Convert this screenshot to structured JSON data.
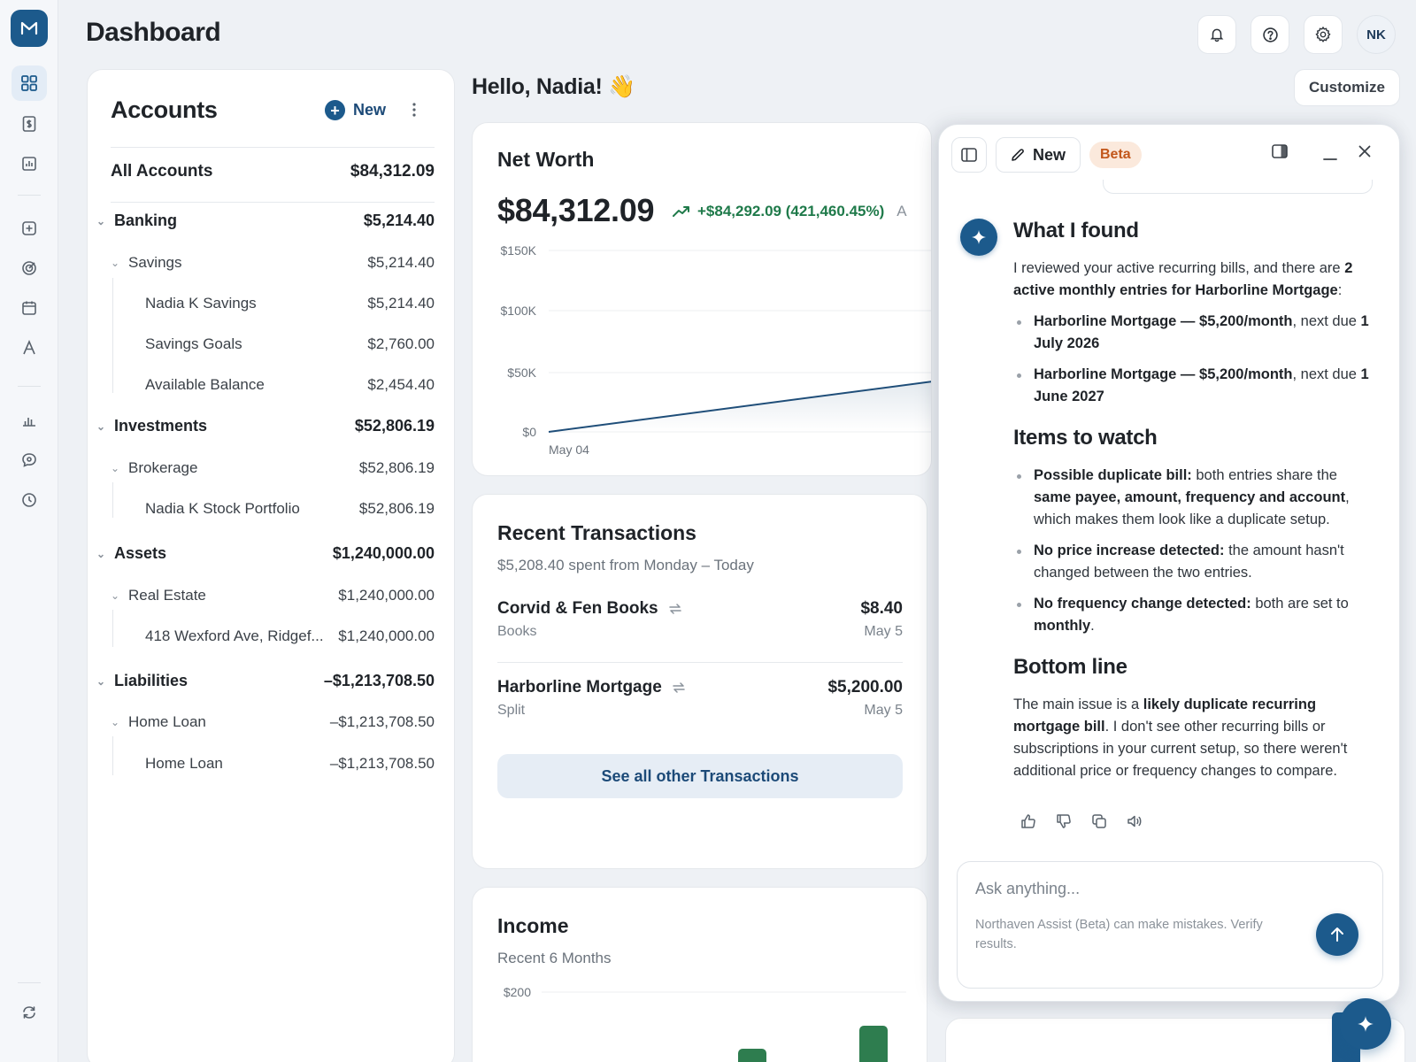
{
  "header": {
    "title": "Dashboard",
    "avatar_initials": "NK"
  },
  "rail": {
    "logo_letter": "M",
    "icons": [
      "grid-icon",
      "dollar-document-icon",
      "bar-chart-icon",
      "plus-square-icon",
      "target-icon",
      "calendar-icon",
      "font-icon",
      "stats-icon",
      "chat-dollar-icon",
      "clock-icon",
      "sync-icon"
    ]
  },
  "accounts": {
    "title": "Accounts",
    "new_label": "New",
    "all": {
      "label": "All Accounts",
      "value": "$84,312.09"
    },
    "groups": [
      {
        "label": "Banking",
        "value": "$5,214.40"
      },
      {
        "label": "Savings",
        "value": "$5,214.40"
      },
      {
        "label": "Nadia K Savings",
        "value": "$5,214.40"
      },
      {
        "label": "Savings Goals",
        "value": "$2,760.00"
      },
      {
        "label": "Available Balance",
        "value": "$2,454.40"
      },
      {
        "label": "Investments",
        "value": "$52,806.19"
      },
      {
        "label": "Brokerage",
        "value": "$52,806.19"
      },
      {
        "label": "Nadia K Stock Portfolio",
        "value": "$52,806.19"
      },
      {
        "label": "Assets",
        "value": "$1,240,000.00"
      },
      {
        "label": "Real Estate",
        "value": "$1,240,000.00"
      },
      {
        "label": "418 Wexford Ave, Ridgef...",
        "value": "$1,240,000.00"
      },
      {
        "label": "Liabilities",
        "value": "–$1,213,708.50"
      },
      {
        "label": "Home Loan",
        "value": "–$1,213,708.50"
      },
      {
        "label": "Home Loan",
        "value": "–$1,213,708.50"
      }
    ]
  },
  "greeting": "Hello, Nadia! 👋",
  "customize_label": "Customize",
  "net_worth": {
    "title": "Net Worth",
    "value": "$84,312.09",
    "change": "+$84,292.09 (421,460.45%)",
    "change_clipped": "A",
    "y_ticks": [
      "$150K",
      "$100K",
      "$50K",
      "$0"
    ],
    "x_tick": "May 04",
    "accent": "#1f4e79"
  },
  "transactions": {
    "title": "Recent Transactions",
    "subtitle": "$5,208.40 spent from Monday – Today",
    "items": [
      {
        "name": "Corvid & Fen Books",
        "category": "Books",
        "amount": "$8.40",
        "date": "May 5"
      },
      {
        "name": "Harborline Mortgage",
        "category": "Split",
        "amount": "$5,200.00",
        "date": "May 5"
      }
    ],
    "see_all_label": "See all other Transactions"
  },
  "income": {
    "title": "Income",
    "subtitle": "Recent 6 Months",
    "y_tick": "$200"
  },
  "assistant": {
    "new_label": "New",
    "beta_label": "Beta",
    "heading1": "What I found",
    "intro_a": "I reviewed your active recurring bills, and there are ",
    "intro_b": "2 active monthly entries for Harborline Mortgage",
    "intro_c": ":",
    "found": [
      {
        "bold": "Harborline Mortgage — $5,200/month",
        "rest": ", next due ",
        "bold2": "1 July 2026"
      },
      {
        "bold": "Harborline Mortgage — $5,200/month",
        "rest": ", next due ",
        "bold2": "1 June 2027"
      }
    ],
    "heading2": "Items to watch",
    "watch1_bold": "Possible duplicate bill:",
    "watch1_a": " both entries share the ",
    "watch1_b": "same payee, amount, frequency and account",
    "watch1_c": ", which makes them look like a duplicate setup.",
    "watch2_bold": "No price increase detected:",
    "watch2_rest": " the amount hasn't changed between the two entries.",
    "watch3_bold": "No frequency change detected:",
    "watch3_a": " both are set to ",
    "watch3_b": "monthly",
    "watch3_c": ".",
    "heading3": "Bottom line",
    "bottom_a": "The main issue is a ",
    "bottom_b": "likely duplicate recurring mortgage bill",
    "bottom_c": ". I don't see other recurring bills or subscriptions in your current setup, so there weren't additional price or frequency changes to compare.",
    "input_placeholder": "Ask anything...",
    "disclaimer": "Northaven Assist (Beta) can make mistakes. Verify results."
  }
}
